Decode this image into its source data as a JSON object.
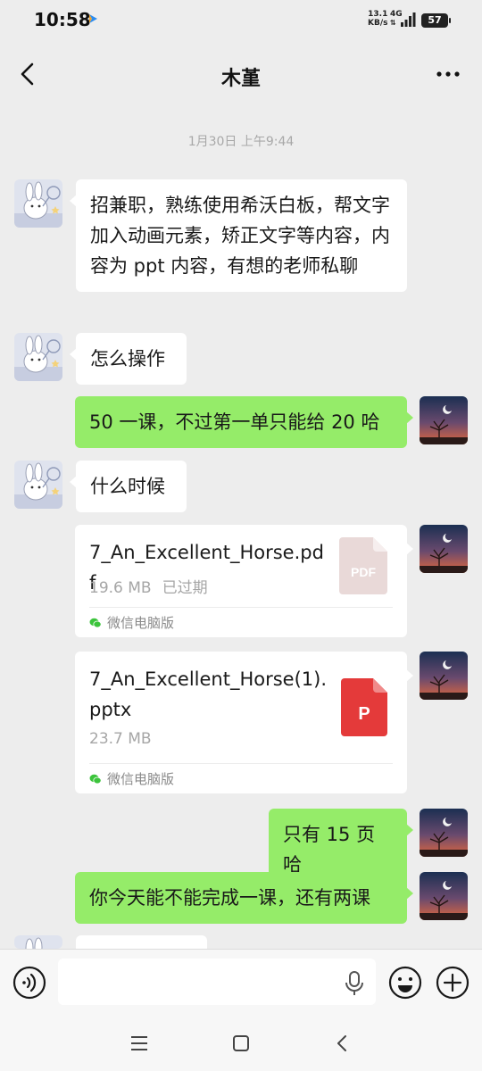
{
  "status_bar": {
    "time": "10:58",
    "net_speed_value": "13.1",
    "net_speed_unit": "KB/s",
    "network": "4G",
    "battery": "57"
  },
  "header": {
    "title": "木堇"
  },
  "chat": {
    "timestamp": "1月30日 上午9:44",
    "messages": [
      {
        "sender": "contact",
        "type": "text",
        "text": "招兼职，熟练使用希沃白板，帮文字加入动画元素，矫正文字等内容，内容为 ppt 内容，有想的老师私聊"
      },
      {
        "sender": "contact",
        "type": "text",
        "text": "怎么操作"
      },
      {
        "sender": "me",
        "type": "text",
        "text": "50 一课，不过第一单只能给 20 哈"
      },
      {
        "sender": "contact",
        "type": "text",
        "text": "什么时候"
      },
      {
        "sender": "me",
        "type": "file",
        "file_name": "7_An_Excellent_Horse.pdf",
        "size": "19.6 MB",
        "status": "已过期",
        "icon_label": "PDF",
        "source": "微信电脑版"
      },
      {
        "sender": "me",
        "type": "file",
        "file_name": "7_An_Excellent_Horse(1).pptx",
        "size": "23.7 MB",
        "status": "",
        "icon_label": "P",
        "source": "微信电脑版"
      },
      {
        "sender": "me",
        "type": "text",
        "text": "只有 15 页哈"
      },
      {
        "sender": "me",
        "type": "text",
        "text": "你今天能不能完成一课，还有两课"
      }
    ]
  },
  "input_bar": {
    "value": "",
    "placeholder": ""
  },
  "icons": {
    "back": "back-arrow-icon",
    "more": "more-dots-icon",
    "voice": "voice-icon",
    "mic": "mic-icon",
    "emoji": "emoji-icon",
    "add": "add-icon",
    "nav_menu": "menu-icon",
    "nav_home": "home-icon",
    "nav_back": "nav-back-icon"
  },
  "colors": {
    "background": "#ededed",
    "outgoing_bubble": "#95ec69",
    "incoming_bubble": "#ffffff",
    "pdf_icon": "#e9d9d8",
    "pptx_icon": "#e43a3a"
  }
}
